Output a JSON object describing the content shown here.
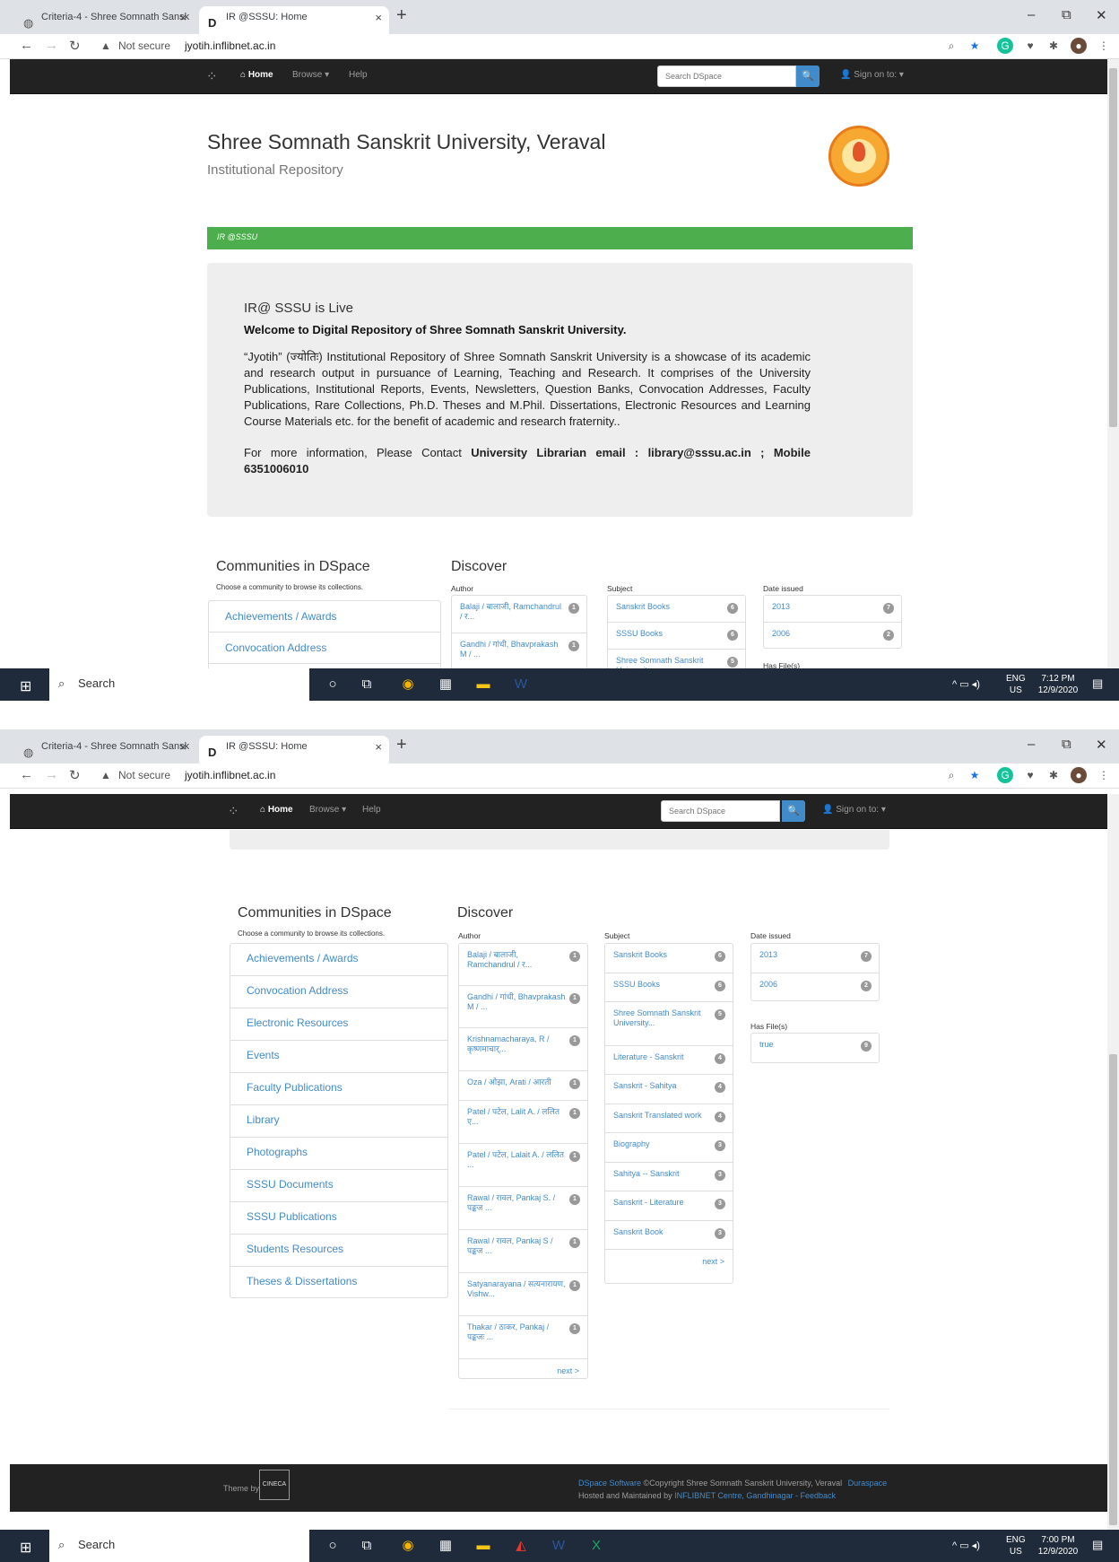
{
  "browser": {
    "tab1_title": "Criteria-4 - Shree Somnath Sansk",
    "tab2_title": "IR @SSSU: Home",
    "tab_close": "×",
    "new_tab": "+",
    "minimize": "–",
    "restore": "⧉",
    "close": "✕",
    "not_secure": "Not secure",
    "url": "jyotih.inflibnet.ac.in"
  },
  "navbar": {
    "home": "Home",
    "browse": "Browse ▾",
    "help": "Help",
    "search_placeholder": "Search DSpace",
    "sign_on": "Sign on to: ▾"
  },
  "header": {
    "title": "Shree Somnath Sanskrit University, Veraval",
    "subtitle": "Institutional Repository"
  },
  "breadcrumb": "IR @SSSU",
  "jumbotron": {
    "heading": "IR@ SSSU is Live",
    "welcome": "Welcome to Digital Repository of Shree Somnath Sanskrit University.",
    "body": "“Jyotih” (ज्योतिः) Institutional Repository of Shree Somnath Sanskrit University is a showcase of its academic and research output in pursuance of Learning, Teaching and Research. It comprises of the University Publications, Institutional Reports, Events, Newsletters, Question Banks, Convocation Addresses, Faculty Publications, Rare Collections, Ph.D. Theses and M.Phil. Dissertations, Electronic Resources and Learning Course Materials etc. for the benefit of academic and research fraternity..",
    "contact_prefix": "For more information, Please Contact ",
    "contact_bold": "University Librarian email : library@sssu.ac.in ; Mobile 6351006010"
  },
  "communities": {
    "heading": "Communities in DSpace",
    "subheading": "Choose a community to browse its collections.",
    "items": [
      "Achievements / Awards",
      "Convocation Address",
      "Electronic Resources",
      "Events",
      "Faculty Publications",
      "Library",
      "Photographs",
      "SSSU Documents",
      "SSSU Publications",
      "Students Resources",
      "Theses & Dissertations"
    ]
  },
  "discover": {
    "heading": "Discover",
    "author_label": "Author",
    "subject_label": "Subject",
    "date_label": "Date issued",
    "hasfile_label": "Has File(s)",
    "next": "next >",
    "authors": [
      {
        "name": "Balaji / बालाजी, Ramchandrul / र...",
        "count": "1"
      },
      {
        "name": "Gandhi / गांधी, Bhavprakash M / ...",
        "count": "1"
      },
      {
        "name": "Krishnamacharaya, R / कृष्णमाचार्...",
        "count": "1"
      },
      {
        "name": "Oza / ओझा, Arati / आरती",
        "count": "1"
      },
      {
        "name": "Patel / पटेल, Lalit A. / ललित ए...",
        "count": "1"
      },
      {
        "name": "Patel / पटेल, Lalait A. / ललित ...",
        "count": "1"
      },
      {
        "name": "Rawal / रावल, Pankaj S. / पङ्कज ...",
        "count": "1"
      },
      {
        "name": "Rawal / रावल, Pankaj S / पङ्कज ...",
        "count": "1"
      },
      {
        "name": "Satyanarayana / सत्यनारायण, Vishw...",
        "count": "1"
      },
      {
        "name": "Thakar / ठाकर, Pankaj / पङ्कजः ...",
        "count": "1"
      }
    ],
    "subjects": [
      {
        "name": "Sanskrit Books",
        "count": "6"
      },
      {
        "name": "SSSU Books",
        "count": "6"
      },
      {
        "name": "Shree Somnath Sanskrit University...",
        "count": "5"
      },
      {
        "name": "Literature - Sanskrit",
        "count": "4"
      },
      {
        "name": "Sanskrit - Sahitya",
        "count": "4"
      },
      {
        "name": "Sanskrit Translated work",
        "count": "4"
      },
      {
        "name": "Biography",
        "count": "3"
      },
      {
        "name": "Sahitya -- Sanskrit",
        "count": "3"
      },
      {
        "name": "Sanskrit - Literature",
        "count": "3"
      },
      {
        "name": "Sanskrit Book",
        "count": "3"
      }
    ],
    "dates": [
      {
        "name": "2013",
        "count": "7"
      },
      {
        "name": "2006",
        "count": "2"
      }
    ],
    "hasfiles": [
      {
        "name": "true",
        "count": "9"
      }
    ]
  },
  "footer": {
    "theme_by": "Theme by",
    "cineca": "CINECA",
    "dspace_link": "DSpace Software",
    "copyright": " ©Copyright Shree Somnath Sanskrit University, Veraval",
    "duraspace": "Duraspace",
    "hosted": "Hosted and Maintained by ",
    "inflibnet": "INFLIBNET Centre, Gandhinagar",
    "feedback": "- Feedback"
  },
  "taskbar": {
    "search": "Search",
    "lang": "ENG",
    "region": "US",
    "time1": "7:12 PM",
    "date1": "12/9/2020",
    "time2": "7:00 PM",
    "date2": "12/9/2020"
  },
  "colors": {
    "navbar": "#222222",
    "breadcrumb": "#4cae4c",
    "link": "#428bca",
    "search_button": "#428bca",
    "taskbar": "#1f2b3a"
  }
}
